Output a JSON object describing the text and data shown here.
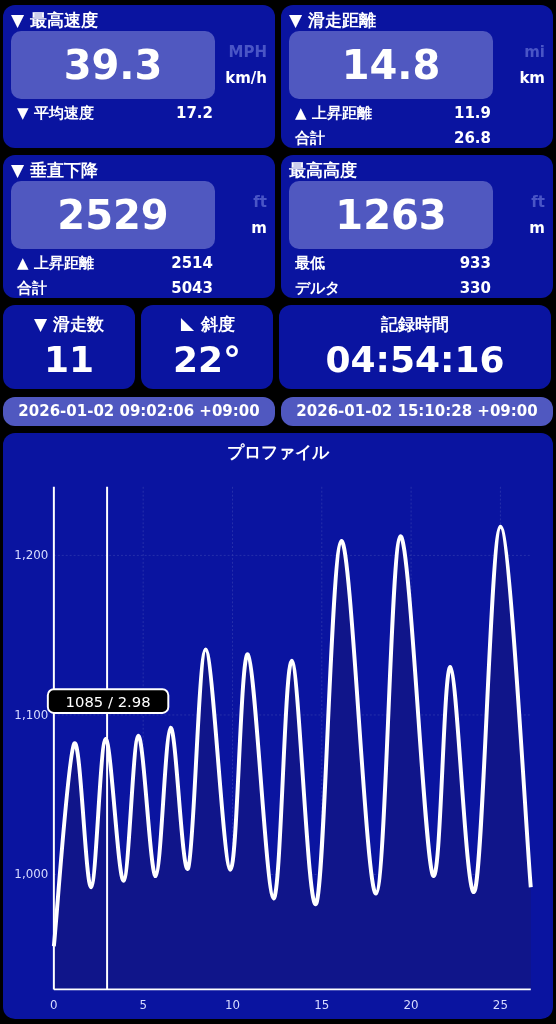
{
  "stat_cards": [
    {
      "label": "▼ 最高速度",
      "value": "39.3",
      "units": [
        {
          "label": "MPH",
          "selected": false
        },
        {
          "label": "km/h",
          "selected": true
        }
      ],
      "rows": [
        {
          "label": "▼ 平均速度",
          "value": "17.2"
        }
      ]
    },
    {
      "label": "▼ 滑走距離",
      "value": "14.8",
      "units": [
        {
          "label": "mi",
          "selected": false
        },
        {
          "label": "km",
          "selected": true
        }
      ],
      "rows": [
        {
          "label": "▲ 上昇距離",
          "value": "11.9"
        },
        {
          "label": "合計",
          "value": "26.8"
        }
      ]
    },
    {
      "label": "▼ 垂直下降",
      "value": "2529",
      "units": [
        {
          "label": "ft",
          "selected": false
        },
        {
          "label": "m",
          "selected": true
        }
      ],
      "rows": [
        {
          "label": "▲ 上昇距離",
          "value": "2514"
        },
        {
          "label": "合計",
          "value": "5043"
        }
      ]
    },
    {
      "label": "最高高度",
      "value": "1263",
      "units": [
        {
          "label": "ft",
          "selected": false
        },
        {
          "label": "m",
          "selected": true
        }
      ],
      "rows": [
        {
          "label": "最低",
          "value": "933"
        },
        {
          "label": "デルタ",
          "value": "330"
        }
      ]
    }
  ],
  "small_cards": [
    {
      "kind": "plain",
      "label": "▼ 滑走数",
      "value": "11"
    },
    {
      "kind": "slope",
      "label": "斜度",
      "value": "22°"
    },
    {
      "kind": "plain",
      "label": "記録時間",
      "value": "04:54:16"
    }
  ],
  "timestamps": [
    "2026-01-02 09:02:06 +09:00",
    "2026-01-02 15:10:28 +09:00"
  ],
  "profile": {
    "chart_data": {
      "type": "area",
      "title": "プロファイル",
      "x": [
        0,
        1.14,
        2.08,
        2.9,
        3.9,
        4.73,
        5.7,
        6.54,
        7.52,
        8.5,
        9.88,
        10.86,
        12.3,
        13.32,
        14.7,
        16.1,
        18.03,
        19.4,
        21.2,
        22.2,
        23.57,
        25.0,
        26.7
      ],
      "series": [
        {
          "color": "#ffffff",
          "values": [
            955,
            1082,
            992,
            1085,
            996,
            1087,
            999,
            1092,
            1004,
            1141,
            1003,
            1138,
            985,
            1134,
            982,
            1209,
            988,
            1212,
            1000,
            1130,
            990,
            1218,
            992
          ]
        }
      ],
      "xlim": [
        0,
        26.7
      ],
      "ylim": [
        928,
        1243
      ],
      "xticks": [
        0,
        5,
        10,
        15,
        20,
        25
      ],
      "yticks": [
        {
          "value": 1000,
          "label": "1,000"
        },
        {
          "value": 1100,
          "label": "1,100"
        },
        {
          "value": 1200,
          "label": "1,200"
        }
      ],
      "grid": true,
      "ref_lines": [
        {
          "axis": "x",
          "value": 2.98
        }
      ],
      "annotations": [
        "1085 / 2.98"
      ]
    }
  }
}
